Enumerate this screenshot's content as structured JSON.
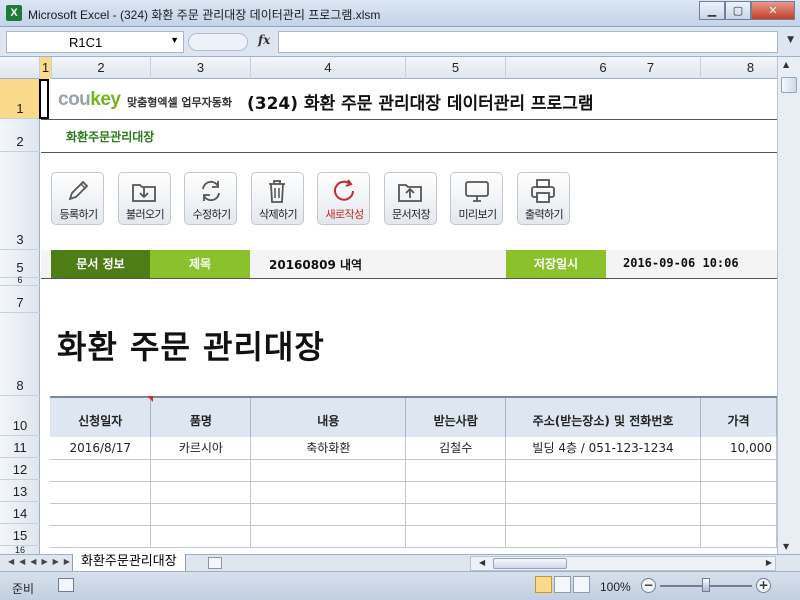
{
  "window": {
    "title": "Microsoft Excel - (324) 화환 주문 관리대장 데이터관리 프로그램.xlsm",
    "app_icon": "X"
  },
  "formula": {
    "name_box": "R1C1",
    "fx": "fx",
    "value": ""
  },
  "columns": [
    "1",
    "2",
    "3",
    "4",
    "5",
    "6",
    "7",
    "8"
  ],
  "rows": [
    "1",
    "2",
    "3",
    "5",
    "6",
    "7",
    "8",
    "10",
    "11",
    "12",
    "13",
    "14",
    "15",
    "16"
  ],
  "header": {
    "logo_brand_a": "cou",
    "logo_brand_b": "key",
    "logo_tag": "맞춤형엑셀 업무자동화",
    "title": "(324) 화환 주문 관리대장 데이터관리 프로그램",
    "subtitle": "화환주문관리대장"
  },
  "toolbar": {
    "buttons": [
      {
        "label": "등록하기",
        "icon": "pencil-icon"
      },
      {
        "label": "불러오기",
        "icon": "folder-download-icon"
      },
      {
        "label": "수정하기",
        "icon": "refresh-icon"
      },
      {
        "label": "삭제하기",
        "icon": "trash-icon"
      },
      {
        "label": "새로작성",
        "icon": "new-doc-icon"
      },
      {
        "label": "문서저장",
        "icon": "folder-upload-icon"
      },
      {
        "label": "미리보기",
        "icon": "monitor-icon"
      },
      {
        "label": "출력하기",
        "icon": "printer-icon"
      }
    ]
  },
  "info": {
    "doc_info_label": "문서 정보",
    "subject_label": "제목",
    "subject_value": "20160809 내역",
    "saved_label": "저장일시",
    "saved_value": "2016-09-06 10:06"
  },
  "big_title": "화환 주문 관리대장",
  "table": {
    "headers": [
      "신청일자",
      "품명",
      "내용",
      "받는사람",
      "주소(받는장소) 및 전화번호",
      "가격"
    ],
    "rows": [
      [
        "2016/8/17",
        "카르시아",
        "축하화환",
        "김철수",
        "빌딩 4층 / 051-123-1234",
        "10,000"
      ],
      [
        "",
        "",
        "",
        "",
        "",
        ""
      ],
      [
        "",
        "",
        "",
        "",
        "",
        ""
      ],
      [
        "",
        "",
        "",
        "",
        "",
        ""
      ],
      [
        "",
        "",
        "",
        "",
        "",
        ""
      ]
    ]
  },
  "sheet_tab": "화환주문관리대장",
  "status": {
    "ready": "준비",
    "zoom": "100%"
  },
  "colors": {
    "dark_green": "#4e7d16",
    "light_green": "#8ac12d",
    "header_fill": "#dde6f1",
    "accent_red": "#c4282a"
  }
}
